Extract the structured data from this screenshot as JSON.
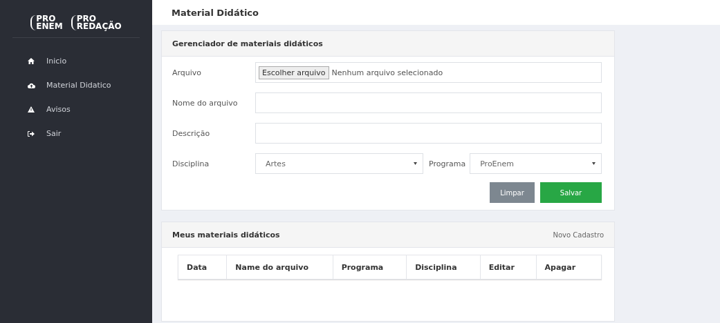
{
  "sidebar": {
    "logo": [
      {
        "line1": "PRO",
        "line2": "ENEM"
      },
      {
        "line1": "PRO",
        "line2": "REDAÇÃO"
      }
    ],
    "items": [
      {
        "kind": "home",
        "label": "Inicio"
      },
      {
        "kind": "upload",
        "label": "Material Didatico"
      },
      {
        "kind": "warning",
        "label": "Avisos"
      },
      {
        "kind": "logout",
        "label": "Sair"
      }
    ]
  },
  "page_title": "Material Didático",
  "manager": {
    "title": "Gerenciador de materiais didáticos",
    "file": {
      "label": "Arquivo",
      "button": "Escolher arquivo",
      "status": "Nenhum arquivo selecionado"
    },
    "fields": [
      {
        "label": "Nome do arquivo"
      },
      {
        "label": "Descrição"
      }
    ],
    "discipline": {
      "label": "Disciplina",
      "value": "Artes"
    },
    "program": {
      "label": "Programa",
      "value": "ProEnem"
    },
    "buttons": [
      {
        "kind": "secondary",
        "label": "Limpar"
      },
      {
        "kind": "primary",
        "label": "Salvar"
      }
    ]
  },
  "materials": {
    "title": "Meus materiais didáticos",
    "action": "Novo Cadastro",
    "columns": [
      "Data",
      "Name do arquivo",
      "Programa",
      "Disciplina",
      "Editar",
      "Apagar"
    ]
  }
}
